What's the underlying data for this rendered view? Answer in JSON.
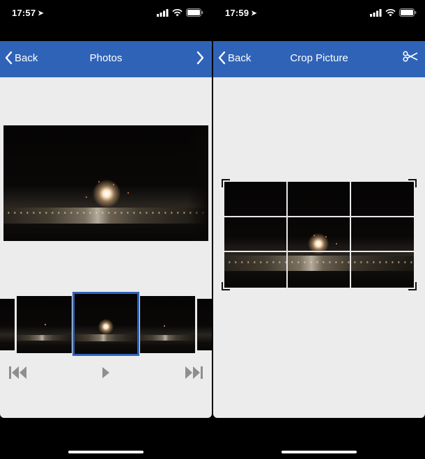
{
  "left_screen": {
    "status": {
      "time": "17:57"
    },
    "nav": {
      "back_label": "Back",
      "title": "Photos"
    }
  },
  "right_screen": {
    "status": {
      "time": "17:59"
    },
    "nav": {
      "back_label": "Back",
      "title": "Crop Picture"
    }
  },
  "icons": {
    "location": "location-arrow-icon",
    "signal": "cellular-signal-icon",
    "wifi": "wifi-icon",
    "battery": "battery-icon",
    "back": "chevron-left-icon",
    "next": "chevron-right-icon",
    "crop": "scissors-icon",
    "skip_back": "skip-to-start-icon",
    "play": "play-icon",
    "skip_forward": "skip-to-end-icon"
  },
  "colors": {
    "nav_bar": "#2f63b8",
    "background": "#ececec",
    "selection": "#2f63b8",
    "controls": "#8e8e8e"
  }
}
